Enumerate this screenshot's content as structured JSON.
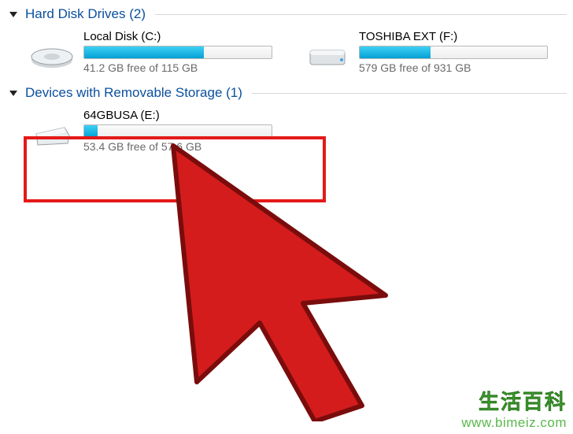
{
  "sections": [
    {
      "title": "Hard Disk Drives (2)",
      "items": [
        {
          "label": "Local Disk (C:)",
          "free_text": "41.2 GB free of 115 GB",
          "fill_percent": 64
        },
        {
          "label": "TOSHIBA EXT (F:)",
          "free_text": "579 GB free of 931 GB",
          "fill_percent": 38
        }
      ]
    },
    {
      "title": "Devices with Removable Storage (1)",
      "items": [
        {
          "label": "64GBUSA (E:)",
          "free_text": "53.4 GB free of 57.6 GB",
          "fill_percent": 7
        }
      ]
    }
  ],
  "watermark": {
    "cn": "生活百科",
    "url": "www.bimeiz.com"
  }
}
